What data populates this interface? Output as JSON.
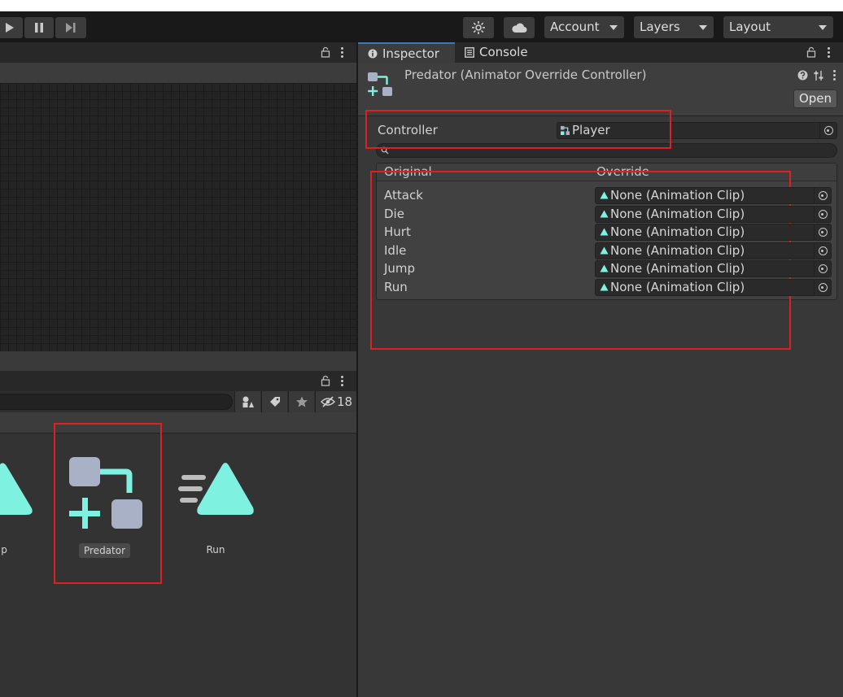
{
  "toolbar": {
    "account_label": "Account",
    "layers_label": "Layers",
    "layout_label": "Layout"
  },
  "project": {
    "hidden_count": "18",
    "assets": [
      {
        "label": "Jump",
        "visible_label": "p",
        "icon": "animation-clip-icon"
      },
      {
        "label": "Predator",
        "icon": "animator-override-controller-icon",
        "selected": true
      },
      {
        "label": "Run",
        "icon": "animation-clip-icon"
      }
    ]
  },
  "inspector": {
    "tabs": [
      {
        "label": "Inspector",
        "icon": "info-icon",
        "active": true
      },
      {
        "label": "Console",
        "icon": "console-icon",
        "active": false
      }
    ],
    "title": "Predator (Animator Override Controller)",
    "open_label": "Open",
    "controller_label": "Controller",
    "controller_value": "Player",
    "table": {
      "col_original": "Original",
      "col_override": "Override",
      "rows": [
        {
          "original": "Attack",
          "override": "None (Animation Clip)"
        },
        {
          "original": "Die",
          "override": "None (Animation Clip)"
        },
        {
          "original": "Hurt",
          "override": "None (Animation Clip)"
        },
        {
          "original": "Idle",
          "override": "None (Animation Clip)"
        },
        {
          "original": "Jump",
          "override": "None (Animation Clip)"
        },
        {
          "original": "Run",
          "override": "None (Animation Clip)"
        }
      ]
    }
  },
  "colors": {
    "accent_teal": "#7ff1e0",
    "asset_grey": "#a9b1c6",
    "highlight_red": "#e02020"
  }
}
